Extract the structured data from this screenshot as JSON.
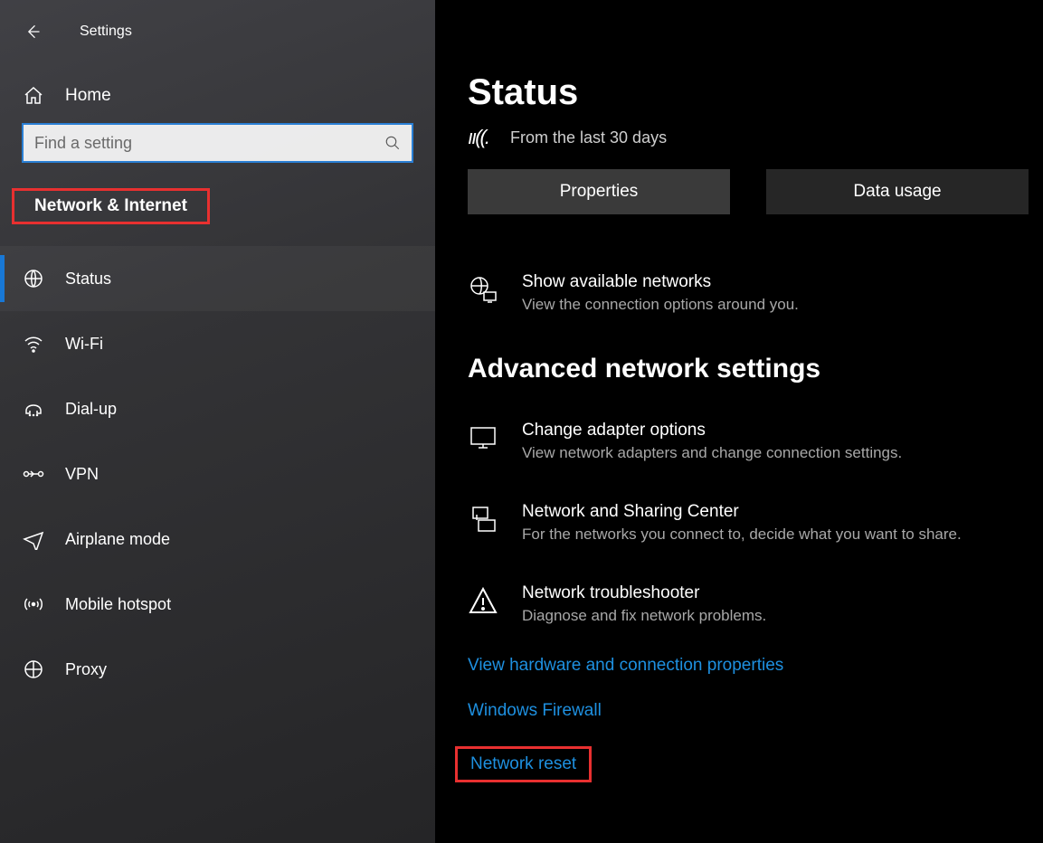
{
  "header": {
    "title": "Settings"
  },
  "sidebar": {
    "home_label": "Home",
    "search_placeholder": "Find a setting",
    "category_label": "Network & Internet",
    "items": [
      {
        "label": "Status"
      },
      {
        "label": "Wi-Fi"
      },
      {
        "label": "Dial-up"
      },
      {
        "label": "VPN"
      },
      {
        "label": "Airplane mode"
      },
      {
        "label": "Mobile hotspot"
      },
      {
        "label": "Proxy"
      }
    ]
  },
  "main": {
    "page_title": "Status",
    "status_subtitle": "From the last 30 days",
    "button_properties": "Properties",
    "button_data_usage": "Data usage",
    "show_networks": {
      "title": "Show available networks",
      "desc": "View the connection options around you."
    },
    "advanced_section_title": "Advanced network settings",
    "adapter": {
      "title": "Change adapter options",
      "desc": "View network adapters and change connection settings."
    },
    "sharing": {
      "title": "Network and Sharing Center",
      "desc": "For the networks you connect to, decide what you want to share."
    },
    "troubleshooter": {
      "title": "Network troubleshooter",
      "desc": "Diagnose and fix network problems."
    },
    "link_hardware": "View hardware and connection properties",
    "link_firewall": "Windows Firewall",
    "link_reset": "Network reset"
  }
}
